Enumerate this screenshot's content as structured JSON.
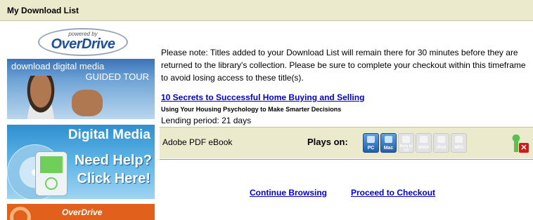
{
  "header": {
    "title": "My Download List"
  },
  "sidebar": {
    "overdrive_logo": {
      "powered_by": "powered by",
      "brand": "OverDrive"
    },
    "tour_banner": {
      "line1": "download digital media",
      "line2": "GUIDED TOUR"
    },
    "help_banner": {
      "title": "Digital Media",
      "line1": "Need Help?",
      "line2": "Click Here!"
    },
    "overdrive_banner": {
      "brand": "OverDrive"
    }
  },
  "main": {
    "notice": "Please note: Titles added to your Download List will remain there for 30 minutes before they are returned to the library's collection. Please be sure to complete your checkout within this timeframe to avoid losing access to these title(s).",
    "item": {
      "title": "10 Secrets to Successful Home Buying and Selling",
      "subtitle": "Using Your Housing Psychology to Make Smarter Decisions",
      "lending_period": "Lending period: 21 days",
      "format": "Adobe PDF eBook",
      "plays_on_label": "Plays on:",
      "devices": [
        {
          "label": "PC",
          "icon": "pc-icon",
          "active": true
        },
        {
          "label": "Mac",
          "icon": "mac-icon",
          "active": true
        },
        {
          "label": "Burn to CD",
          "icon": "burn-cd-icon",
          "active": false
        },
        {
          "label": "WMA",
          "icon": "wma-icon",
          "active": false
        },
        {
          "label": "iPod",
          "icon": "ipod-icon",
          "active": false
        },
        {
          "label": "MP3",
          "icon": "mp3-icon",
          "active": false
        }
      ]
    },
    "links": {
      "continue": "Continue Browsing",
      "checkout": "Proceed to Checkout"
    }
  },
  "colors": {
    "header_bg": "#eceacd",
    "link": "#0000cc",
    "active_device": "#2b6fc0"
  }
}
